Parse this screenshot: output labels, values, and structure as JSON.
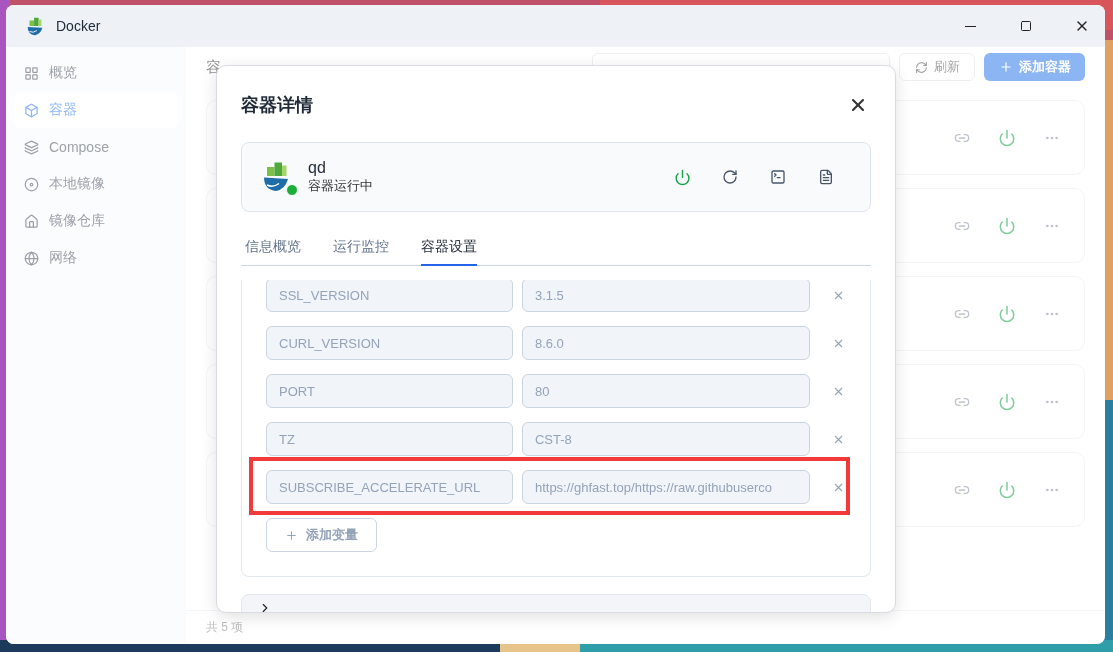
{
  "window": {
    "title": "Docker"
  },
  "sidebar": {
    "items": [
      {
        "label": "概览",
        "selected": false
      },
      {
        "label": "容器",
        "selected": true
      },
      {
        "label": "Compose",
        "selected": false
      },
      {
        "label": "本地镜像",
        "selected": false
      },
      {
        "label": "镜像仓库",
        "selected": false
      },
      {
        "label": "网络",
        "selected": false
      }
    ]
  },
  "main": {
    "title": "容",
    "refresh_button": "刷新",
    "add_button": "添加容器",
    "cards": [
      {
        "running": true
      },
      {
        "running": true
      },
      {
        "running": true
      },
      {
        "running": true
      },
      {
        "running": true
      }
    ],
    "footer": "共 5 项"
  },
  "dialog": {
    "title": "容器详情",
    "container": {
      "name": "qd",
      "status": "容器运行中",
      "running": true
    },
    "tabs": [
      {
        "label": "信息概览",
        "selected": false
      },
      {
        "label": "运行监控",
        "selected": false
      },
      {
        "label": "容器设置",
        "selected": true
      }
    ],
    "env": [
      {
        "name": "SSL_VERSION",
        "value": "3.1.5",
        "highlighted": false
      },
      {
        "name": "CURL_VERSION",
        "value": "8.6.0",
        "highlighted": false
      },
      {
        "name": "PORT",
        "value": "80",
        "highlighted": false
      },
      {
        "name": "TZ",
        "value": "CST-8",
        "highlighted": false
      },
      {
        "name": "SUBSCRIBE_ACCELERATE_URL",
        "value": "https://ghfast.top/https://raw.githubuserco",
        "highlighted": true
      }
    ],
    "add_variable_button": "添加变量",
    "sections": [
      {
        "expanded": false
      }
    ]
  }
}
